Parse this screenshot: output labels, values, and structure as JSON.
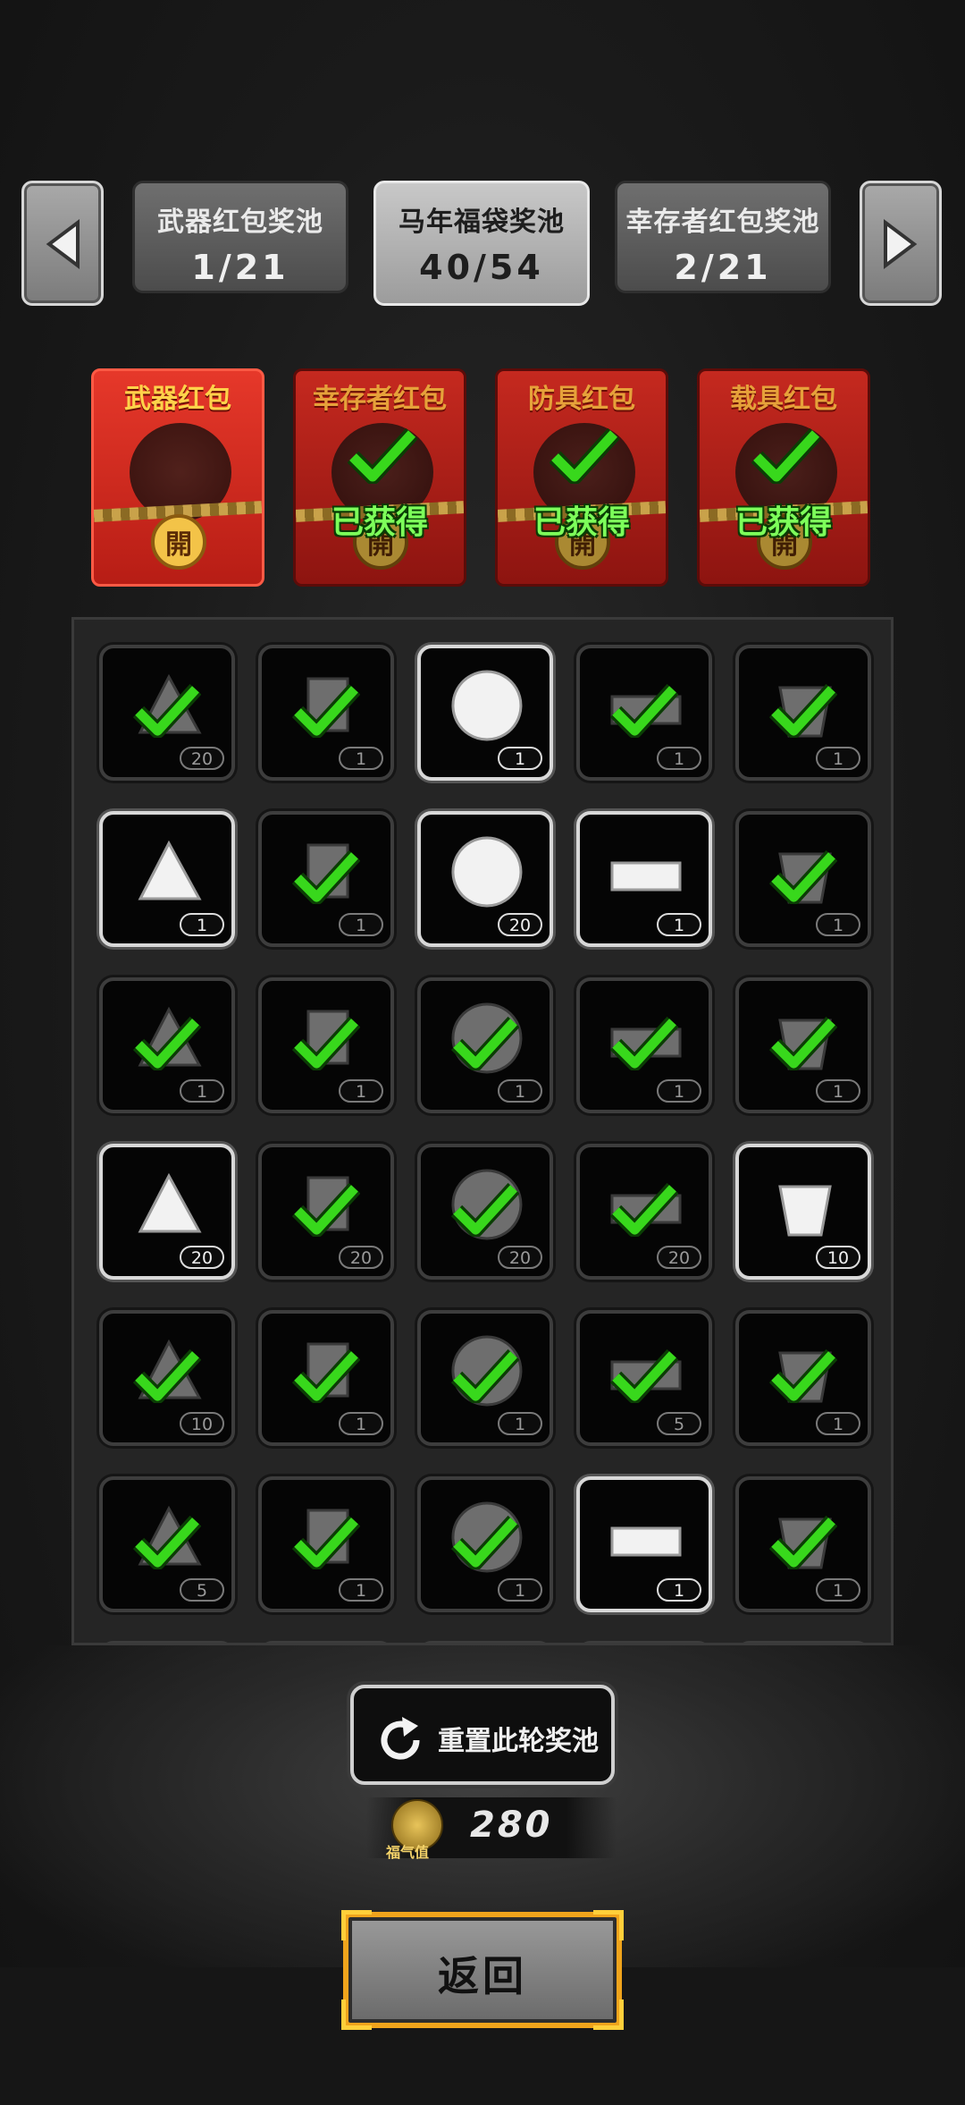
{
  "pool_tabs": [
    {
      "name": "武器红包奖池",
      "count": "1/21"
    },
    {
      "name": "马年福袋奖池",
      "count": "40/54",
      "active": true
    },
    {
      "name": "幸存者红包奖池",
      "count": "2/21"
    }
  ],
  "envelopes": [
    {
      "title": "武器红包",
      "status": "",
      "seal": "開"
    },
    {
      "title": "幸存者红包",
      "status": "已获得",
      "seal": "開"
    },
    {
      "title": "防具红包",
      "status": "已获得",
      "seal": "開"
    },
    {
      "title": "载具红包",
      "status": "已获得",
      "seal": "開"
    }
  ],
  "items": [
    {
      "icon": "spike-icon",
      "qty": "20",
      "claimed": true
    },
    {
      "icon": "flask-icon",
      "qty": "1",
      "claimed": true
    },
    {
      "icon": "gold-nuggets-icon",
      "qty": "1",
      "claimed": false
    },
    {
      "icon": "planks-icon",
      "qty": "1",
      "claimed": true
    },
    {
      "icon": "gears-icon",
      "qty": "1",
      "claimed": true
    },
    {
      "icon": "cloth-icon",
      "qty": "1",
      "claimed": false
    },
    {
      "icon": "blade-icon",
      "qty": "1",
      "claimed": true
    },
    {
      "icon": "cash-stack-icon",
      "qty": "20",
      "claimed": false
    },
    {
      "icon": "gold-bars-icon",
      "qty": "1",
      "claimed": false
    },
    {
      "icon": "vase-icon",
      "qty": "1",
      "claimed": true
    },
    {
      "icon": "ring-icon",
      "qty": "1",
      "claimed": true
    },
    {
      "icon": "food-bowl-icon",
      "qty": "1",
      "claimed": true
    },
    {
      "icon": "coffee-cup-icon",
      "qty": "1",
      "claimed": true
    },
    {
      "icon": "fruit-bowl-icon",
      "qty": "1",
      "claimed": true
    },
    {
      "icon": "toolbox-icon",
      "qty": "1",
      "claimed": true
    },
    {
      "icon": "battery-icon",
      "qty": "20",
      "claimed": false
    },
    {
      "icon": "shell-icon",
      "qty": "20",
      "claimed": true
    },
    {
      "icon": "fuel-barrel-icon",
      "qty": "20",
      "claimed": true
    },
    {
      "icon": "bullet-icon",
      "qty": "20",
      "claimed": true
    },
    {
      "icon": "pen-icon",
      "qty": "10",
      "claimed": false
    },
    {
      "icon": "flashlight-icon",
      "qty": "10",
      "claimed": true
    },
    {
      "icon": "drink-cup-icon",
      "qty": "1",
      "claimed": true
    },
    {
      "icon": "jar-icon",
      "qty": "1",
      "claimed": true
    },
    {
      "icon": "globe-net-icon",
      "qty": "5",
      "claimed": true
    },
    {
      "icon": "juice-glass-icon",
      "qty": "1",
      "claimed": true
    },
    {
      "icon": "mesh-dome-icon",
      "qty": "5",
      "claimed": true
    },
    {
      "icon": "claw-icon",
      "qty": "1",
      "claimed": true
    },
    {
      "icon": "fabric-stack-icon",
      "qty": "1",
      "claimed": true
    },
    {
      "icon": "bread-icon",
      "qty": "1",
      "claimed": false
    },
    {
      "icon": "bottle-icon",
      "qty": "1",
      "claimed": true
    }
  ],
  "reset_label": "重置此轮奖池",
  "luck": {
    "label": "福气值",
    "value": "280"
  },
  "back_label": "返回",
  "colors": {
    "check": "#38d81c",
    "envelope_red": "#c5291f",
    "gold_frame": "#f0a41c"
  }
}
